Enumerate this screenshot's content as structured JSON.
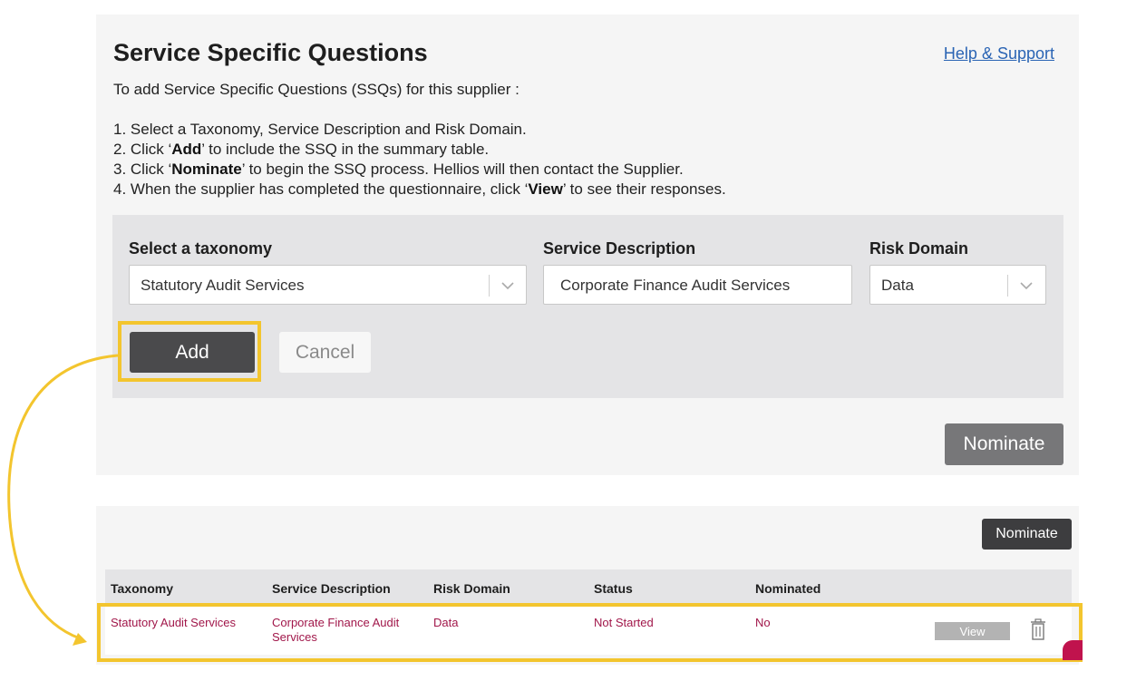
{
  "header": {
    "title": "Service Specific Questions",
    "help_link": "Help & Support"
  },
  "intro": "To add Service Specific Questions (SSQs) for this supplier :",
  "steps": [
    {
      "prefix": "1. Select a Taxonomy, Service Description and Risk Domain.",
      "bold": "",
      "suffix": ""
    },
    {
      "prefix": "2. Click ‘",
      "bold": "Add",
      "suffix": "’ to include the SSQ in the summary table."
    },
    {
      "prefix": "3. Click ‘",
      "bold": "Nominate",
      "suffix": "’ to begin the SSQ process. Hellios will then contact the Supplier."
    },
    {
      "prefix": "4. When the supplier has completed the questionnaire, click ‘",
      "bold": "View",
      "suffix": "’ to see their responses."
    }
  ],
  "form": {
    "taxonomy_label": "Select a taxonomy",
    "taxonomy_value": "Statutory Audit Services",
    "service_label": "Service Description",
    "service_value": "Corporate Finance Audit Services",
    "risk_label": "Risk Domain",
    "risk_value": "Data",
    "add_label": "Add",
    "cancel_label": "Cancel"
  },
  "nominate_label": "Nominate",
  "summary": {
    "nominate_label": "Nominate",
    "columns": [
      "Taxonomy",
      "Service Description",
      "Risk Domain",
      "Status",
      "Nominated"
    ],
    "rows": [
      {
        "taxonomy": "Statutory Audit Services",
        "service": "Corporate Finance Audit Services",
        "risk": "Data",
        "status": "Not Started",
        "nominated": "No",
        "view_label": "View"
      }
    ]
  },
  "colors": {
    "highlight": "#f3c52e",
    "link": "#2a64b4",
    "row_text": "#a1174a",
    "primary_button": "#4a4a4c"
  },
  "icons": [
    "chevron-down-icon",
    "trash-icon",
    "arrow-annotation"
  ]
}
